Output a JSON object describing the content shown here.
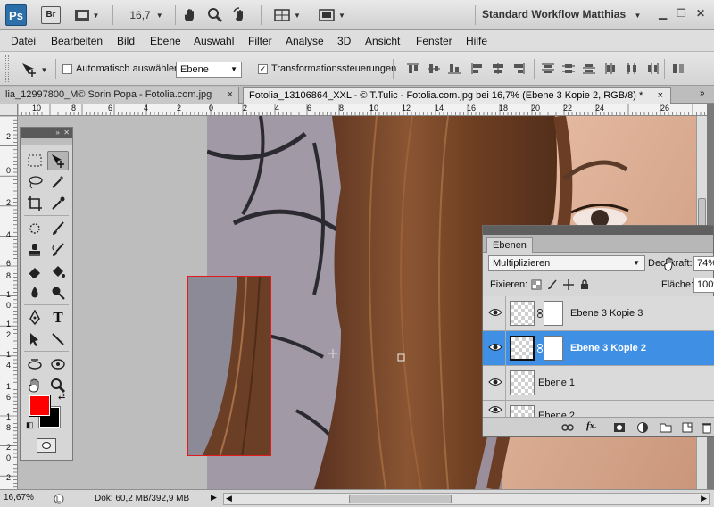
{
  "appbar": {
    "logo": "Ps",
    "bridge": "Br",
    "zoom": "16,7",
    "workspace": "Standard Workflow Matthias"
  },
  "menu": [
    "Datei",
    "Bearbeiten",
    "Bild",
    "Ebene",
    "Auswahl",
    "Filter",
    "Analyse",
    "3D",
    "Ansicht",
    "Fenster",
    "Hilfe"
  ],
  "options": {
    "auto_select_label": "Automatisch auswählen:",
    "auto_select_value": "Ebene",
    "transform_label": "Transformationssteuerungen"
  },
  "tabs": [
    {
      "label": "lia_12997800_M© Sorin Popa - Fotolia.com.jpg",
      "close": "×"
    },
    {
      "label": "Fotolia_13106864_XXL - © T.Tulic - Fotolia.com.jpg bei 16,7% (Ebene 3 Kopie 2, RGB/8) *",
      "close": "×"
    }
  ],
  "rulers": {
    "top": [
      "10",
      "8",
      "6",
      "4",
      "2",
      "0",
      "2",
      "4",
      "6",
      "8",
      "10",
      "12",
      "14",
      "16",
      "18",
      "20",
      "22",
      "24",
      "26"
    ],
    "left": [
      "2",
      "0",
      "2",
      "4",
      "6",
      "8",
      "1",
      "0",
      "1",
      "2",
      "1",
      "4",
      "1",
      "6",
      "1",
      "8",
      "2",
      "0",
      "2"
    ]
  },
  "layers_panel": {
    "tab": "Ebenen",
    "blend_mode": "Multiplizieren",
    "opacity_label": "Deckkraft:",
    "opacity_value": "74%",
    "lock_label": "Fixieren:",
    "fill_label": "Fläche:",
    "fill_value": "100%",
    "layers": [
      {
        "name": "Ebene 3 Kopie 3",
        "selected": false,
        "mask": true
      },
      {
        "name": "Ebene 3 Kopie 2",
        "selected": true,
        "mask": true
      },
      {
        "name": "Ebene 1",
        "selected": false,
        "mask": false
      },
      {
        "name": "Ebene 2",
        "selected": false,
        "mask": false
      }
    ]
  },
  "status": {
    "zoom": "16,67%",
    "doc_info": "Dok: 60,2 MB/392,9 MB"
  },
  "colors": {
    "foreground": "#ff0000",
    "background": "#000000",
    "selection_blue": "#3f8fe4",
    "crop_border": "#e01b1b"
  }
}
